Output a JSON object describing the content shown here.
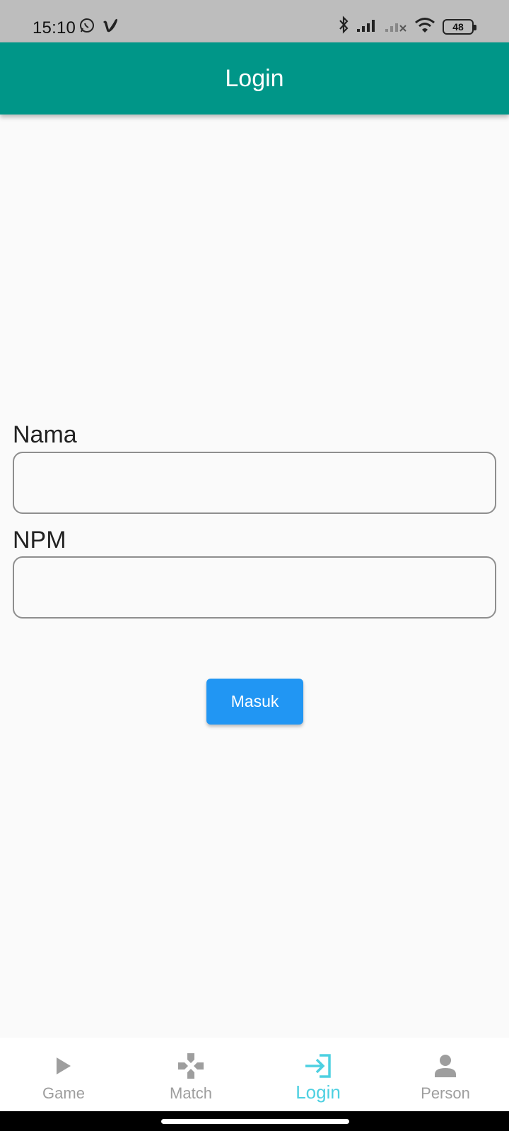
{
  "status_bar": {
    "time": "15:10",
    "battery": "48",
    "icons": [
      "whatsapp-icon",
      "vimeo-icon",
      "bluetooth-icon",
      "signal-icon",
      "signal-off-icon",
      "wifi-icon",
      "battery-icon"
    ]
  },
  "app_bar": {
    "title": "Login",
    "color": "#009688"
  },
  "form": {
    "name_label": "Nama",
    "name_value": "",
    "npm_label": "NPM",
    "npm_value": "",
    "submit_label": "Masuk",
    "submit_color": "#2196f3"
  },
  "bottom_nav": {
    "items": [
      {
        "label": "Game",
        "icon": "play-icon",
        "active": false
      },
      {
        "label": "Match",
        "icon": "gamepad-icon",
        "active": false
      },
      {
        "label": "Login",
        "icon": "login-icon",
        "active": true
      },
      {
        "label": "Person",
        "icon": "person-icon",
        "active": false
      }
    ],
    "active_color": "#4dd0e1",
    "inactive_color": "#9e9e9e"
  }
}
